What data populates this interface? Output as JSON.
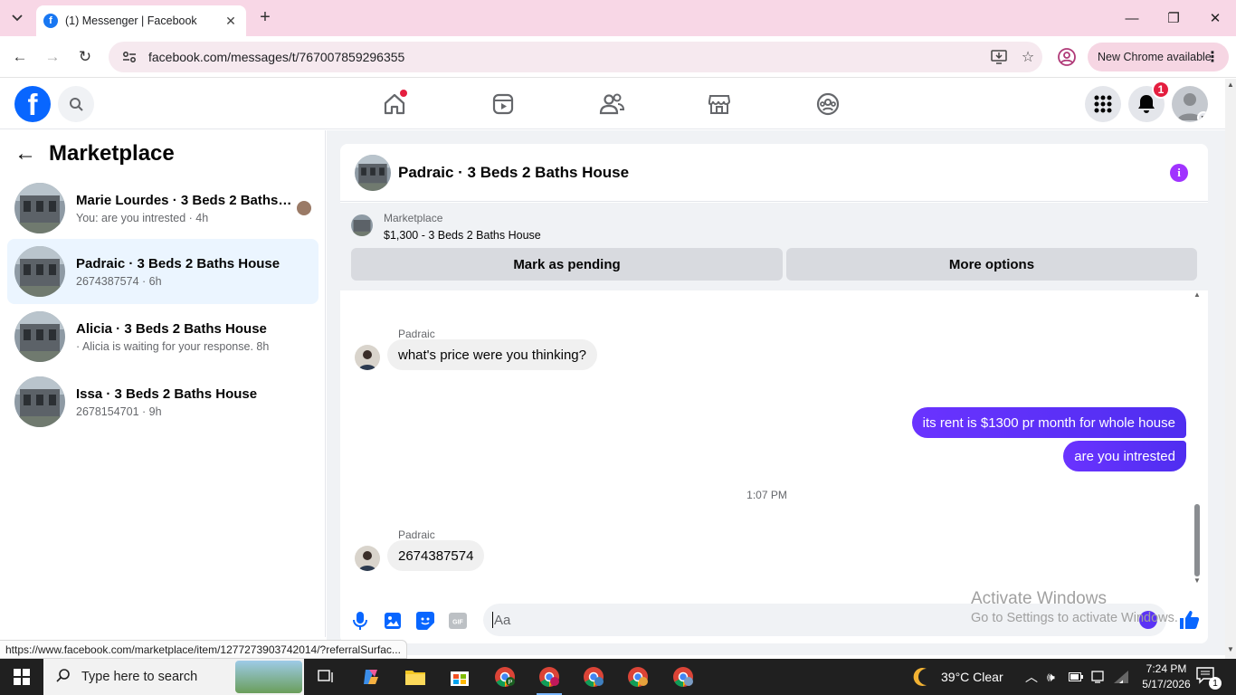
{
  "browser": {
    "tab_title": "(1) Messenger | Facebook",
    "url": "facebook.com/messages/t/767007859296355",
    "new_chrome_label": "New Chrome available",
    "status_url": "https://www.facebook.com/marketplace/item/1277273903742014/?referralSurfac..."
  },
  "fbnav": {
    "notification_count": "1",
    "icons": [
      "home-icon",
      "reels-icon",
      "friends-icon",
      "marketplace-icon",
      "groups-icon"
    ]
  },
  "sidebar": {
    "title": "Marketplace",
    "conversations": [
      {
        "name": "Marie Lourdes · 3 Beds 2 Baths ...",
        "sub": "You: are you intrested · 4h",
        "active": false
      },
      {
        "name": "Padraic · 3 Beds 2 Baths House",
        "sub": "2674387574 · 6h",
        "active": true
      },
      {
        "name": "Alicia · 3 Beds 2 Baths House",
        "sub": " · Alicia is waiting for your response. 8h",
        "active": false
      },
      {
        "name": "Issa · 3 Beds 2 Baths House",
        "sub": "2678154701 · 9h",
        "active": false
      }
    ]
  },
  "chat": {
    "title": "Padraic · 3 Beds 2 Baths House",
    "listing_label": "Marketplace",
    "listing_price": "$1,300 - 3 Beds 2 Baths House",
    "mark_pending_label": "Mark as pending",
    "more_options_label": "More options",
    "messages": [
      {
        "sender": "Padraic",
        "text": "what's price were you thinking?",
        "direction": "in"
      },
      {
        "text": "its rent is $1300 pr month for whole house",
        "direction": "out"
      },
      {
        "text": "are you intrested",
        "direction": "out"
      },
      {
        "timestamp": "1:07 PM"
      },
      {
        "sender": "Padraic",
        "text": "2674387574",
        "direction": "in"
      }
    ],
    "composer_placeholder": "Aa"
  },
  "watermark": {
    "line1": "Activate Windows",
    "line2": "Go to Settings to activate Windows."
  },
  "taskbar": {
    "search_placeholder": "Type here to search",
    "weather": "39°C  Clear",
    "time": "7:24 PM",
    "date": "5/17/2026",
    "notif_count": "1"
  },
  "colors": {
    "brand_blue": "#0866ff",
    "message_out": "#5b33f5",
    "tab_strip": "#f8d7e6"
  }
}
